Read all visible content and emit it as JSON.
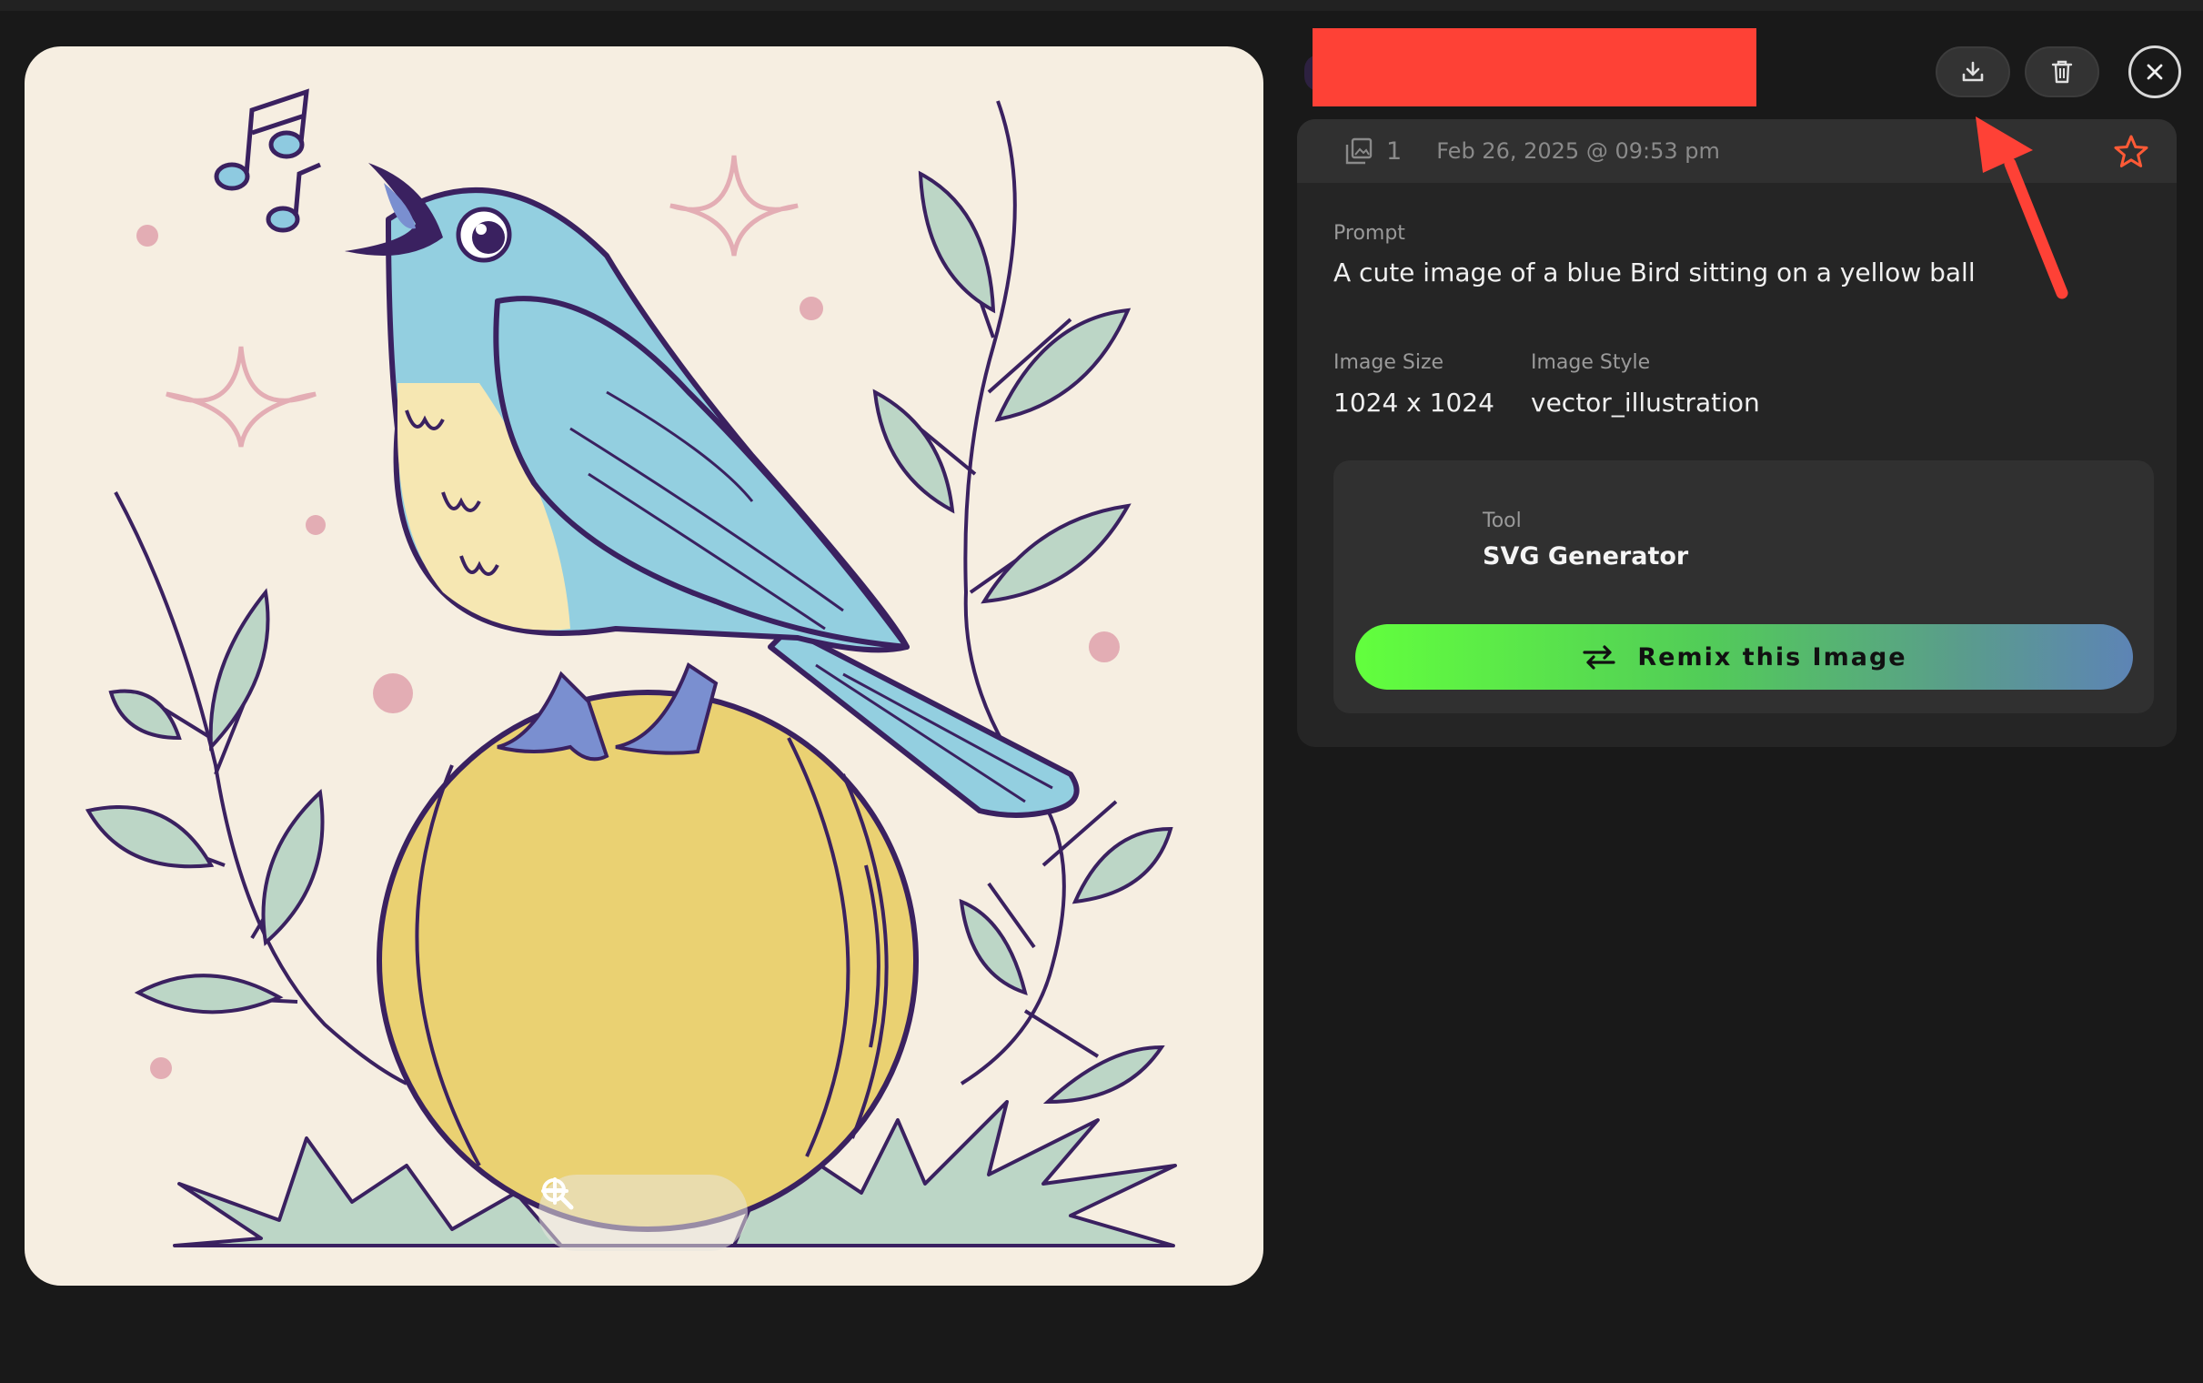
{
  "viewer": {
    "zoom": {
      "zoom_out_icon": "minus-icon",
      "zoom_reset_icon": "magnifier-icon",
      "zoom_in_icon": "plus-icon"
    }
  },
  "toolbar": {
    "download_icon": "download-icon",
    "delete_icon": "trash-icon",
    "close_icon": "close-icon"
  },
  "details": {
    "image_count": "1",
    "date": "Feb 26, 2025 @ 09:53 pm",
    "prompt_label": "Prompt",
    "prompt": "A cute image of a blue Bird sitting on a yellow ball",
    "size_label": "Image Size",
    "size": "1024 x 1024",
    "style_label": "Image Style",
    "style": "vector_illustration"
  },
  "tool": {
    "label": "Tool",
    "name": "SVG Generator",
    "remix_label": "Remix this Image"
  },
  "colors": {
    "background": "#191919",
    "panel": "#252525",
    "redaction": "#fe4136",
    "star": "#ff5a36",
    "remix_gradient_start": "#62ff3d",
    "remix_gradient_end": "#5d84b5"
  }
}
